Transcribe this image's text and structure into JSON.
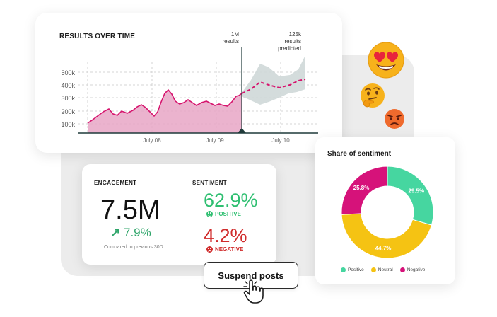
{
  "chart": {
    "title": "RESULTS OVER TIME",
    "annotation_now": [
      "1M",
      "results"
    ],
    "annotation_pred": [
      "125k",
      "results",
      "predicted"
    ],
    "y_ticks": [
      "500k",
      "400k",
      "300k",
      "200k",
      "100k"
    ],
    "x_ticks": [
      "July 08",
      "July 09",
      "July 10"
    ],
    "colors": {
      "area": "#e8a6c6",
      "line": "#d6156e",
      "forecast_band": "#cfd8d8"
    }
  },
  "engagement": {
    "label": "ENGAGEMENT",
    "value": "7.5M",
    "delta": "7.9%",
    "compare": "Compared to previous 30D"
  },
  "sentiment": {
    "label": "SENTIMENT",
    "positive_value": "62.9%",
    "positive_label": "POSITIVE",
    "negative_value": "4.2%",
    "negative_label": "NEGATIVE"
  },
  "action": {
    "suspend_label": "Suspend posts"
  },
  "share": {
    "title": "Share of sentiment",
    "slice_labels": {
      "positive": "29.5%",
      "neutral": "44.7%",
      "negative": "25.8%"
    },
    "legend": {
      "positive": "Positive",
      "neutral": "Neutral",
      "negative": "Negative"
    },
    "colors": {
      "positive": "#46d6a0",
      "neutral": "#f5c313",
      "negative": "#d6127a"
    }
  },
  "chart_data": {
    "type": "pie",
    "title": "Share of sentiment",
    "categories": [
      "Positive",
      "Neutral",
      "Negative"
    ],
    "values": [
      29.5,
      44.7,
      25.8
    ]
  },
  "emojis": [
    "heart-eyes-emoji",
    "thinking-emoji",
    "angry-emoji"
  ]
}
